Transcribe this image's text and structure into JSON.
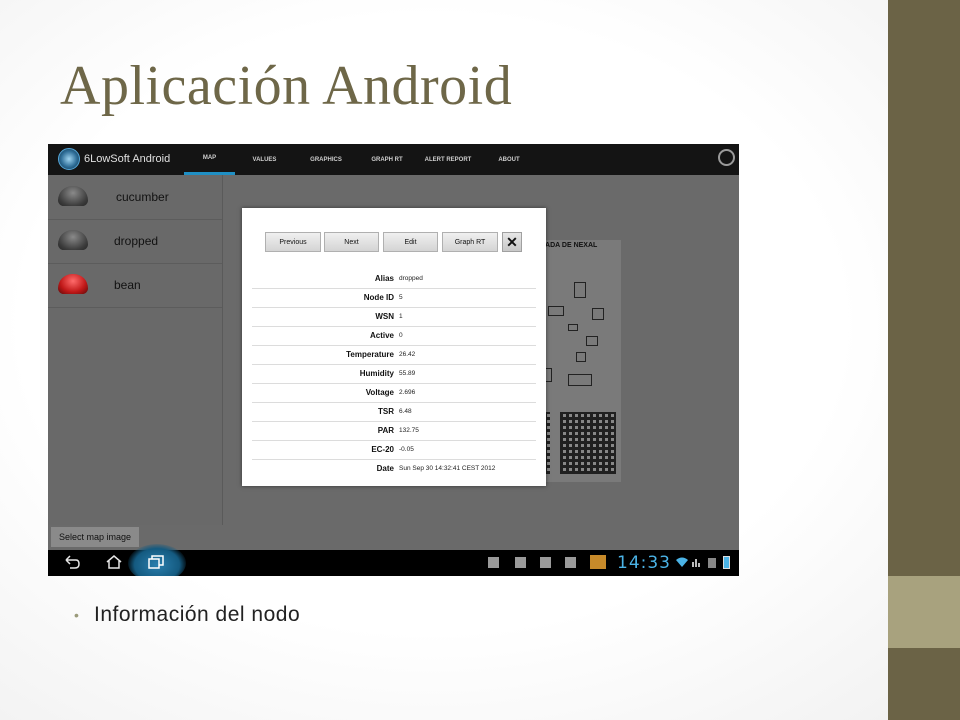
{
  "slide": {
    "title": "Aplicación Android",
    "bullet": "Información del nodo",
    "colors": {
      "title": "#6e6748",
      "sidebar_dark": "#6b6346",
      "sidebar_light": "#a8a27e"
    }
  },
  "app": {
    "name": "6LowSoft Android",
    "tabs": [
      "MAP",
      "VALUES",
      "GRAPHICS",
      "GRAPH RT",
      "ALERT REPORT",
      "ABOUT"
    ],
    "active_tab": "MAP",
    "accent": "#1f8fc4"
  },
  "nodes": [
    {
      "name": "cucumber",
      "status": "grey"
    },
    {
      "name": "dropped",
      "status": "grey"
    },
    {
      "name": "bean",
      "status": "red"
    }
  ],
  "select_map_button": "Select map image",
  "map_heading": "RADA DE NEXAL",
  "dialog": {
    "buttons": {
      "previous": "Previous",
      "next": "Next",
      "edit": "Edit",
      "graph_rt": "Graph RT",
      "close_icon": "close-icon"
    },
    "fields": [
      {
        "label": "Alias",
        "value": "dropped"
      },
      {
        "label": "Node ID",
        "value": "5"
      },
      {
        "label": "WSN",
        "value": "1"
      },
      {
        "label": "Active",
        "value": "0"
      },
      {
        "label": "Temperature",
        "value": "26.42"
      },
      {
        "label": "Humidity",
        "value": "55.89"
      },
      {
        "label": "Voltage",
        "value": "2.696"
      },
      {
        "label": "TSR",
        "value": "6.48"
      },
      {
        "label": "PAR",
        "value": "132.75"
      },
      {
        "label": "EC-20",
        "value": "-0.05"
      },
      {
        "label": "Date",
        "value": "Sun Sep 30 14:32:41 CEST 2012"
      }
    ]
  },
  "statusbar": {
    "time": "14:33",
    "icons": [
      "back-icon",
      "home-icon",
      "recent-apps-icon",
      "notification-icon",
      "wifi-icon",
      "signal-icon",
      "battery-icon"
    ]
  }
}
